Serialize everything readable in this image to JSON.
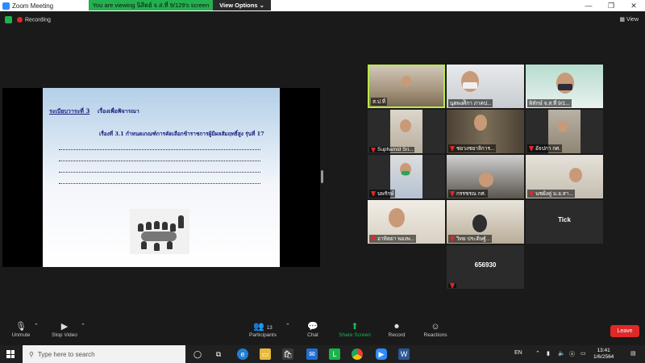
{
  "window": {
    "title": "Zoom Meeting",
    "controls": [
      "—",
      "❐",
      "✕"
    ]
  },
  "banner": {
    "message": "You are viewing นิสิตย์ จ.ส.ที่ 9/129's screen",
    "options_label": "View Options ⌄"
  },
  "meeting": {
    "recording_label": "Recording",
    "view_label": "View"
  },
  "slide": {
    "agenda_label": "ระเบียบวาระที่ 3",
    "agenda_title": "เรื่องเพื่อพิจารณา",
    "subject": "เรื่องที่ 3.1 กำหนดเกณฑ์การคัดเลือกข้าราชการผู้มีผลสัมฤทธิ์สูง รุ่นที่ 17"
  },
  "participants": [
    {
      "name": "ส.ป.ที่",
      "active": true
    },
    {
      "name": "นุตพงศ์ิกา ภาคป...",
      "active": false
    },
    {
      "name": "พิทักษ์ จ.ส.ที่ 9/1...",
      "active": false
    },
    {
      "name": "Suphamid Sri...",
      "active": false
    },
    {
      "name": "ชยวงชยาลิการ...",
      "active": false
    },
    {
      "name": "อัจปกา กศ.",
      "active": false
    },
    {
      "name": "นพรักษ์",
      "active": false
    },
    {
      "name": "กรรชรณ กศ.",
      "active": false
    },
    {
      "name": "นชผั่งคู่ ม.อ.สา...",
      "active": false
    },
    {
      "name": "อาทิตยา พองพ...",
      "active": false
    },
    {
      "name": "วิทย ประดิษฐ์...",
      "active": false
    }
  ],
  "blank_tiles": [
    "Tick",
    "656930"
  ],
  "toolbar": {
    "unmute": "Unmute",
    "stop_video": "Stop Video",
    "participants": "Participants",
    "participants_count": "13",
    "chat": "Chat",
    "share_screen": "Share Screen",
    "record": "Record",
    "reactions": "Reactions",
    "leave": "Leave"
  },
  "taskbar": {
    "search_placeholder": "Type here to search",
    "language": "EN",
    "time": "13:41",
    "date": "1/6/2564"
  },
  "colors": {
    "accent_green": "#23b04e",
    "leave_red": "#e02828",
    "active_border": "#b9e94a"
  }
}
